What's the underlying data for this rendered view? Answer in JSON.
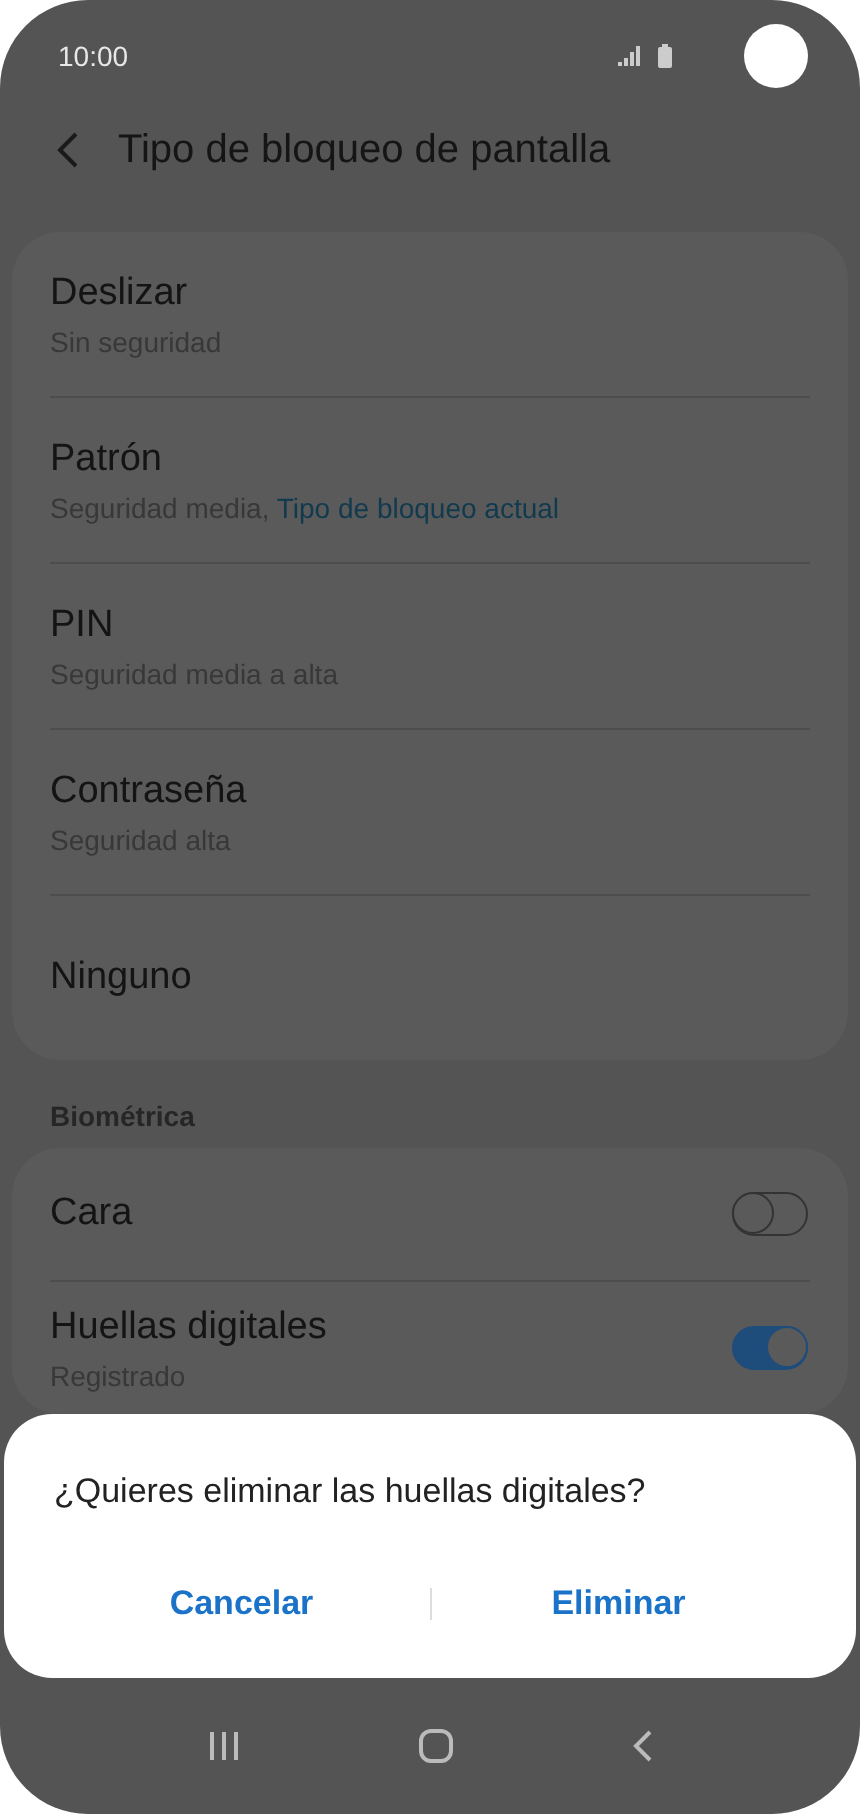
{
  "status_bar": {
    "time": "10:00"
  },
  "header": {
    "title": "Tipo de bloqueo de pantalla"
  },
  "lock_types": [
    {
      "title": "Deslizar",
      "subtitle": "Sin seguridad"
    },
    {
      "title": "Patrón",
      "subtitle": "Seguridad media, ",
      "current_note": "Tipo de bloqueo actual"
    },
    {
      "title": "PIN",
      "subtitle": "Seguridad media a alta"
    },
    {
      "title": "Contraseña",
      "subtitle": "Seguridad alta"
    },
    {
      "title": "Ninguno"
    }
  ],
  "biometrics": {
    "section_title": "Biométrica",
    "items": [
      {
        "title": "Cara",
        "on": false
      },
      {
        "title": "Huellas digitales",
        "subtitle": "Registrado",
        "on": true
      }
    ]
  },
  "dialog": {
    "message": "¿Quieres eliminar las huellas digitales?",
    "buttons": [
      "Cancelar",
      "Eliminar"
    ]
  }
}
